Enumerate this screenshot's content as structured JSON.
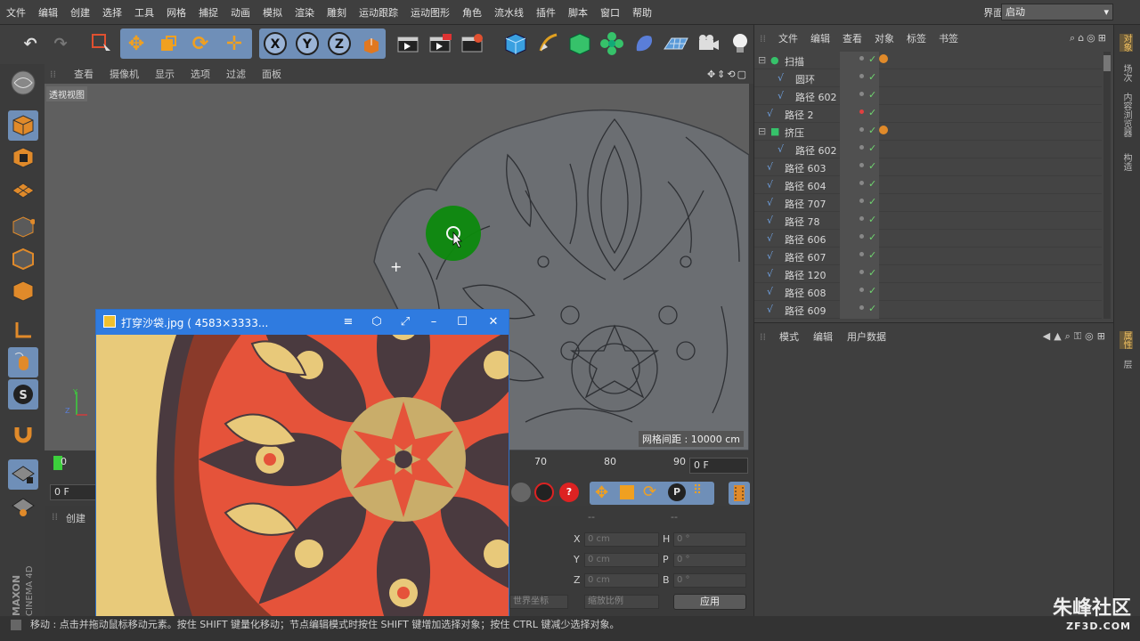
{
  "menubar": {
    "items": [
      "文件",
      "编辑",
      "创建",
      "选择",
      "工具",
      "网格",
      "捕捉",
      "动画",
      "模拟",
      "渲染",
      "雕刻",
      "运动跟踪",
      "运动图形",
      "角色",
      "流水线",
      "插件",
      "脚本",
      "窗口",
      "帮助"
    ],
    "layout_label": "界面:",
    "layout_value": "启动"
  },
  "viewport": {
    "menu": [
      "查看",
      "摄像机",
      "显示",
      "选项",
      "过滤",
      "面板"
    ],
    "label": "透视视图",
    "grid_spacing": "网格间距 : 10000 cm"
  },
  "timeline": {
    "ticks": [
      "0",
      "70",
      "80",
      "90"
    ],
    "frame_end": "0 F",
    "frame_start": "0 F"
  },
  "attr_bottom": {
    "tab": "创建",
    "cols": [
      "X",
      "Y",
      "Z",
      "H",
      "P",
      "B"
    ],
    "values": [
      "0 cm",
      "0 cm",
      "0 cm",
      "0 °",
      "0 °",
      "0 °"
    ],
    "world_coord": "世界坐标",
    "scale": "缩放比例",
    "apply": "应用"
  },
  "objects_panel": {
    "menu": [
      "文件",
      "编辑",
      "查看",
      "对象",
      "标签",
      "书签"
    ],
    "rows": [
      {
        "name": "扫描",
        "indent": 0,
        "dot": "gray"
      },
      {
        "name": "圆环",
        "indent": 1,
        "dot": "gray"
      },
      {
        "name": "路径 602",
        "indent": 1,
        "dot": "gray"
      },
      {
        "name": "路径 2",
        "indent": 0,
        "dot": "red"
      },
      {
        "name": "挤压",
        "indent": 0,
        "dot": "gray"
      },
      {
        "name": "路径 602",
        "indent": 1,
        "dot": "gray"
      },
      {
        "name": "路径 603",
        "indent": 0,
        "dot": "gray"
      },
      {
        "name": "路径 604",
        "indent": 0,
        "dot": "gray"
      },
      {
        "name": "路径 707",
        "indent": 0,
        "dot": "gray"
      },
      {
        "name": "路径 78",
        "indent": 0,
        "dot": "gray"
      },
      {
        "name": "路径 606",
        "indent": 0,
        "dot": "gray"
      },
      {
        "name": "路径 607",
        "indent": 0,
        "dot": "gray"
      },
      {
        "name": "路径 120",
        "indent": 0,
        "dot": "gray"
      },
      {
        "name": "路径 608",
        "indent": 0,
        "dot": "gray"
      },
      {
        "name": "路径 609",
        "indent": 0,
        "dot": "gray"
      }
    ]
  },
  "attributes_panel": {
    "menu": [
      "模式",
      "编辑",
      "用户数据"
    ]
  },
  "right_tabs": [
    "对象",
    "场次",
    "内容浏览器",
    "构造",
    "属性",
    "层"
  ],
  "image_window": {
    "title": "打穿沙袋.jpg ( 4583×3333..."
  },
  "statusbar": {
    "text": "移动 : 点击并拖动鼠标移动元素。按住 SHIFT 键量化移动；节点编辑模式时按住 SHIFT 键增加选择对象；按住 CTRL 键减少选择对象。"
  },
  "brand": {
    "vertical": "MAXON CINEMA 4D",
    "watermark": "朱峰社区",
    "watermark_sub": "ZF3D.COM"
  },
  "colors": {
    "accent_blue": "#6f8fb8",
    "titlebar_blue": "#2f7be0",
    "check_green": "#6fd46f"
  }
}
